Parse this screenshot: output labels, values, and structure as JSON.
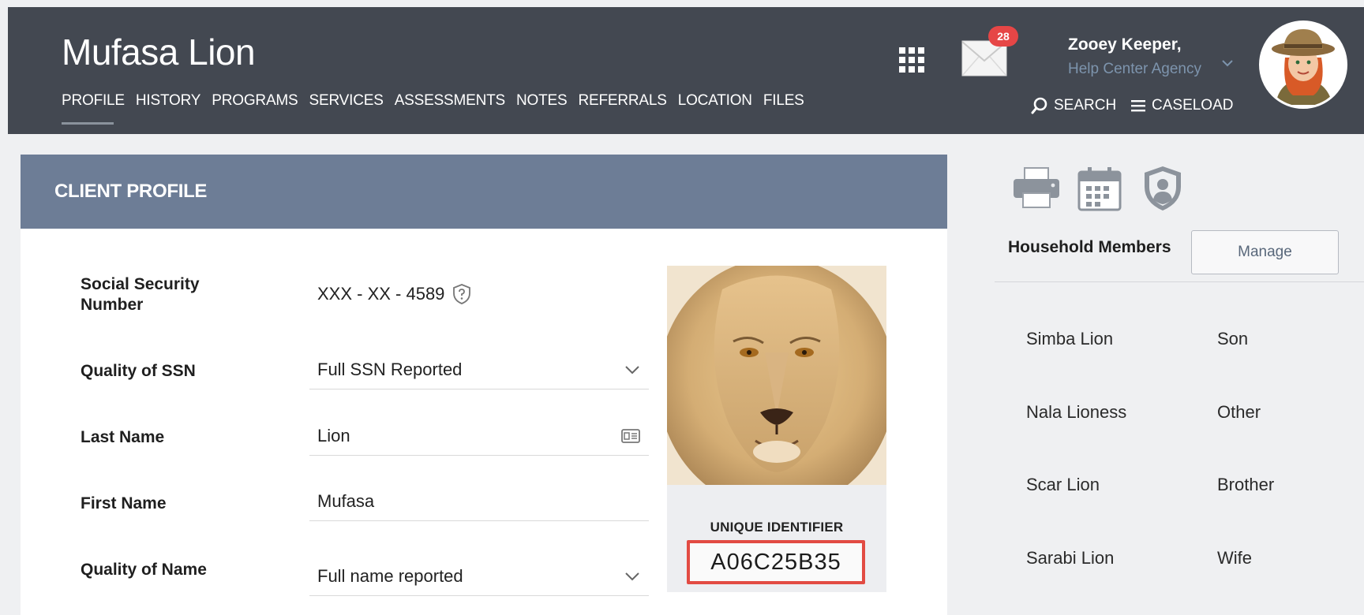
{
  "header": {
    "client_name": "Mufasa Lion",
    "nav": [
      "PROFILE",
      "HISTORY",
      "PROGRAMS",
      "SERVICES",
      "ASSESSMENTS",
      "NOTES",
      "REFERRALS",
      "LOCATION",
      "FILES"
    ],
    "active_nav": "PROFILE",
    "mail_count": "28",
    "user_name": "Zooey Keeper,",
    "user_agency": "Help Center Agency",
    "search_label": "SEARCH",
    "caseload_label": "CASELOAD"
  },
  "profile": {
    "title": "CLIENT PROFILE",
    "fields": [
      {
        "label": "Social Security Number",
        "value": "XXX - XX - 4589"
      },
      {
        "label": "Quality of SSN",
        "value": "Full SSN Reported"
      },
      {
        "label": "Last Name",
        "value": "Lion"
      },
      {
        "label": "First Name",
        "value": "Mufasa"
      },
      {
        "label": "Quality of Name",
        "value": "Full name reported"
      }
    ],
    "unique_identifier_label": "UNIQUE IDENTIFIER",
    "unique_identifier": "A06C25B35"
  },
  "household": {
    "title": "Household Members",
    "manage_label": "Manage",
    "members": [
      {
        "name": "Simba Lion",
        "relation": "Son"
      },
      {
        "name": "Nala Lioness",
        "relation": "Other"
      },
      {
        "name": "Scar Lion",
        "relation": "Brother"
      },
      {
        "name": "Sarabi Lion",
        "relation": "Wife"
      }
    ]
  },
  "colors": {
    "topbar": "#434851",
    "profile_header": "#6d7d96",
    "badge": "#e64646",
    "highlight_border": "#e24b43",
    "agency_text": "#7d94ad"
  },
  "icons": [
    "apps-grid-icon",
    "mail-icon",
    "chevron-down-icon",
    "search-icon",
    "menu-icon",
    "help-shield-icon",
    "id-card-icon",
    "printer-icon",
    "calendar-icon",
    "user-shield-icon"
  ]
}
